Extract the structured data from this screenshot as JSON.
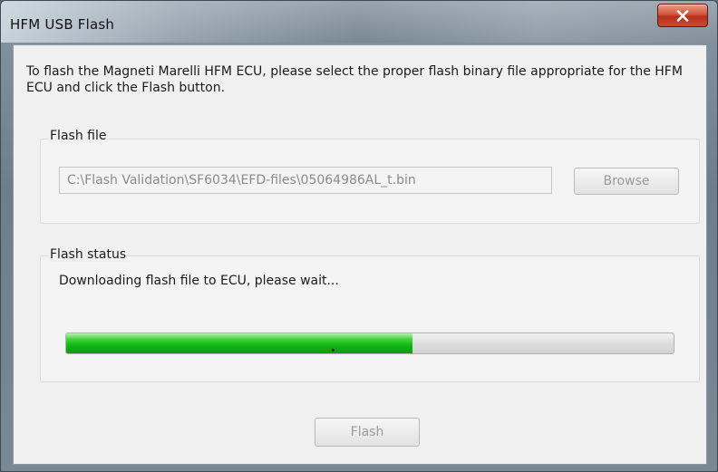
{
  "window": {
    "title": "HFM USB Flash",
    "close_icon": "close-icon"
  },
  "description": "To flash the Magneti Marelli HFM ECU, please select the proper flash binary file appropriate for the HFM ECU and click the Flash button.",
  "flash_file": {
    "label": "Flash file",
    "path_value": "C:\\Flash Validation\\SF6034\\EFD-files\\05064986AL_t.bin",
    "browse_label": "Browse"
  },
  "flash_status": {
    "label": "Flash status",
    "message": "Downloading flash file to ECU, please wait...",
    "progress_fraction": 0.57
  },
  "footer": {
    "flash_label": "Flash"
  },
  "colors": {
    "progress_green": "#12b616",
    "close_red": "#c84a30"
  }
}
